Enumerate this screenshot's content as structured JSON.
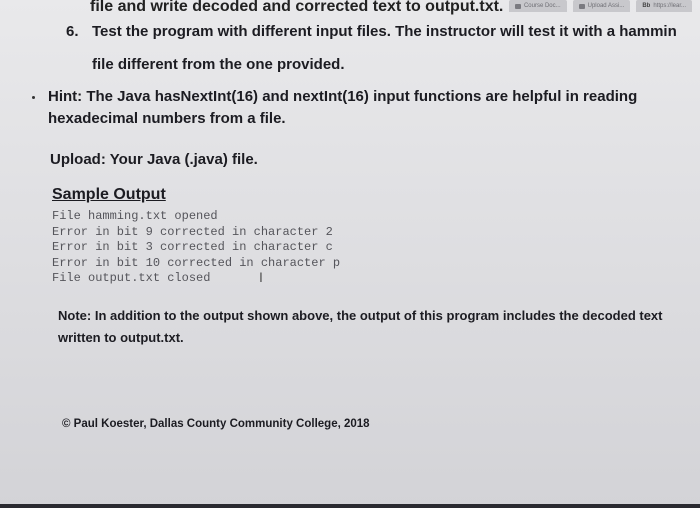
{
  "browser_tabs": [
    {
      "label": "Course Doc..."
    },
    {
      "label": "Upload Assi..."
    },
    {
      "label": "https://lear..."
    }
  ],
  "document": {
    "cut_line": "file and write decoded and corrected text to output.txt.",
    "step6_number": "6.",
    "step6_line1": "Test the program with different input files. The instructor will test it with a hammin",
    "step6_line2": "file different from the one provided.",
    "hint_line1": "Hint: The Java hasNextInt(16) and nextInt(16) input functions are helpful in reading",
    "hint_line2": "hexadecimal numbers from a file.",
    "upload": "Upload: Your Java (.java) file.",
    "sample_heading": "Sample Output",
    "sample_output": [
      "File hamming.txt opened",
      "Error in bit 9 corrected in character 2",
      "Error in bit 3 corrected in character c",
      "Error in bit 10 corrected in character p",
      "File output.txt closed"
    ],
    "note_line1": "Note: In addition to the output shown above, the output of this program includes the decoded text",
    "note_line2": "written to output.txt.",
    "copyright": "© Paul Koester, Dallas County Community College, 2018"
  }
}
